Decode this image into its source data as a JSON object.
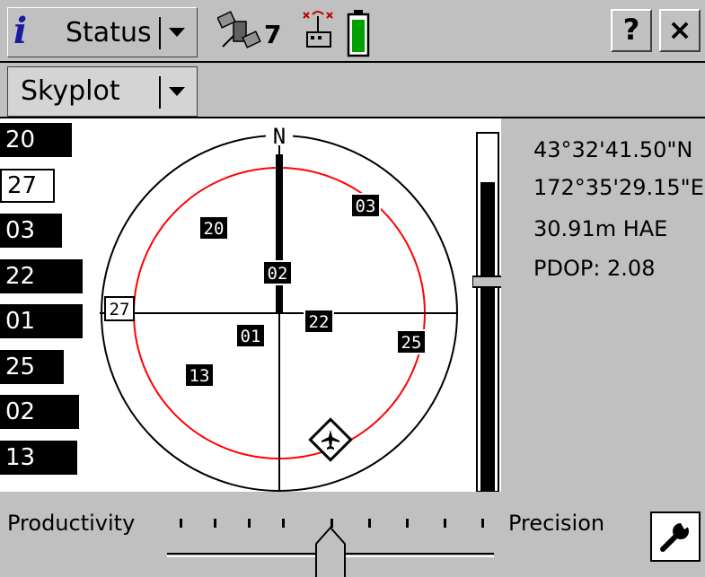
{
  "title_bar": {
    "app_label": "Status",
    "satellite_count": "7",
    "help_label": "?",
    "close_label": "×"
  },
  "view_selector": {
    "label": "Skyplot"
  },
  "skyplot": {
    "north_label": "N",
    "satellites": [
      {
        "id": "20",
        "style": "filled"
      },
      {
        "id": "03",
        "style": "filled"
      },
      {
        "id": "02",
        "style": "filled"
      },
      {
        "id": "27",
        "style": "outlined"
      },
      {
        "id": "22",
        "style": "filled"
      },
      {
        "id": "01",
        "style": "filled"
      },
      {
        "id": "25",
        "style": "filled"
      },
      {
        "id": "13",
        "style": "filled"
      }
    ]
  },
  "signal_bars": [
    {
      "id": "20",
      "level": 0.82,
      "open": false
    },
    {
      "id": "27",
      "level": 0.62,
      "open": true
    },
    {
      "id": "03",
      "level": 0.7,
      "open": false
    },
    {
      "id": "22",
      "level": 0.94,
      "open": false
    },
    {
      "id": "01",
      "level": 0.94,
      "open": false
    },
    {
      "id": "25",
      "level": 0.72,
      "open": false
    },
    {
      "id": "02",
      "level": 0.9,
      "open": false
    },
    {
      "id": "13",
      "level": 0.88,
      "open": false
    }
  ],
  "position": {
    "latitude": "43°32'41.50\"N",
    "longitude": "172°35'29.15\"E",
    "height": "30.91m HAE",
    "pdop": "PDOP: 2.08"
  },
  "elevation_mask": {
    "level": 0.87
  },
  "tuning": {
    "left_label": "Productivity",
    "right_label": "Precision",
    "slider_position": 0.5
  },
  "colors": {
    "accent_red": "#ff0000",
    "battery_green": "#00a000"
  }
}
